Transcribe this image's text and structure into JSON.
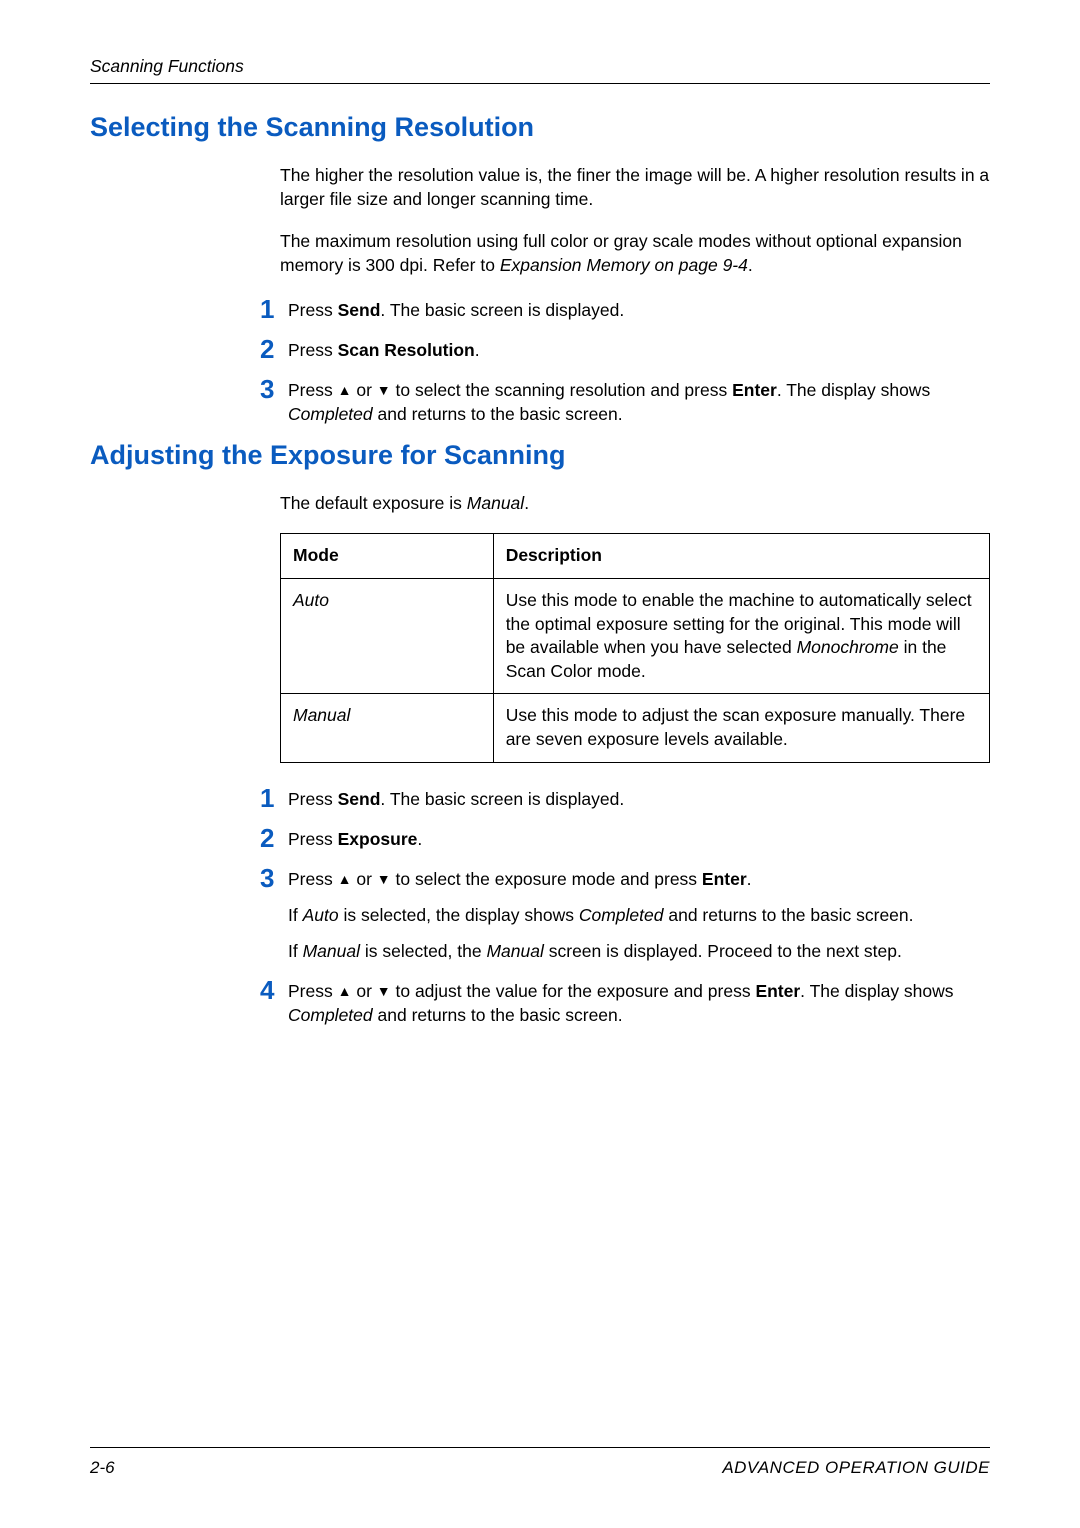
{
  "header": {
    "section": "Scanning Functions"
  },
  "sections": {
    "resolution": {
      "title": "Selecting the Scanning Resolution",
      "para1": "The higher the resolution value is, the finer the image will be. A higher resolution results in a larger file size and longer scanning time.",
      "para2_a": "The maximum resolution using full color or gray scale modes without optional expansion memory is 300 dpi. Refer to ",
      "para2_b": "Expansion Memory on page 9-4",
      "para2_c": ".",
      "steps": {
        "s1_a": "Press ",
        "s1_b": "Send",
        "s1_c": ". The basic screen is displayed.",
        "s2_a": "Press ",
        "s2_b": "Scan Resolution",
        "s2_c": ".",
        "s3_a": "Press ",
        "s3_b": " or ",
        "s3_c": " to select the scanning resolution and press ",
        "s3_d": "Enter",
        "s3_e": ". The display shows ",
        "s3_f": "Completed",
        "s3_g": " and returns to the basic screen."
      }
    },
    "exposure": {
      "title": "Adjusting the Exposure for Scanning",
      "intro_a": "The default exposure is ",
      "intro_b": "Manual",
      "intro_c": ".",
      "table": {
        "h1": "Mode",
        "h2": "Description",
        "r1c1": "Auto",
        "r1c2_a": "Use this mode to enable the machine to automatically select the optimal exposure setting for the original. This mode will be available when you have selected ",
        "r1c2_b": "Monochrome",
        "r1c2_c": " in the Scan Color mode.",
        "r2c1": "Manual",
        "r2c2": "Use this mode to adjust the scan exposure manually. There are seven exposure levels available."
      },
      "steps": {
        "s1_a": "Press ",
        "s1_b": "Send",
        "s1_c": ". The basic screen is displayed.",
        "s2_a": "Press ",
        "s2_b": "Exposure",
        "s2_c": ".",
        "s3_a": "Press ",
        "s3_b": " or ",
        "s3_c": " to select the exposure mode and press ",
        "s3_d": "Enter",
        "s3_e": ".",
        "s3_p2_a": "If ",
        "s3_p2_b": "Auto",
        "s3_p2_c": " is selected, the display shows ",
        "s3_p2_d": "Completed",
        "s3_p2_e": " and returns to the basic screen.",
        "s3_p3_a": "If  ",
        "s3_p3_b": "Manual",
        "s3_p3_c": " is selected, the ",
        "s3_p3_d": "Manual",
        "s3_p3_e": " screen is displayed. Proceed to the next step.",
        "s4_a": "Press ",
        "s4_b": " or ",
        "s4_c": " to adjust the value for the exposure and press ",
        "s4_d": "Enter",
        "s4_e": ". The display shows ",
        "s4_f": "Completed",
        "s4_g": " and returns to the basic screen."
      }
    }
  },
  "numbers": {
    "n1": "1",
    "n2": "2",
    "n3": "3",
    "n4": "4"
  },
  "icons": {
    "up": "▲",
    "down": "▼"
  },
  "footer": {
    "page": "2-6",
    "guide": "ADVANCED OPERATION GUIDE"
  }
}
